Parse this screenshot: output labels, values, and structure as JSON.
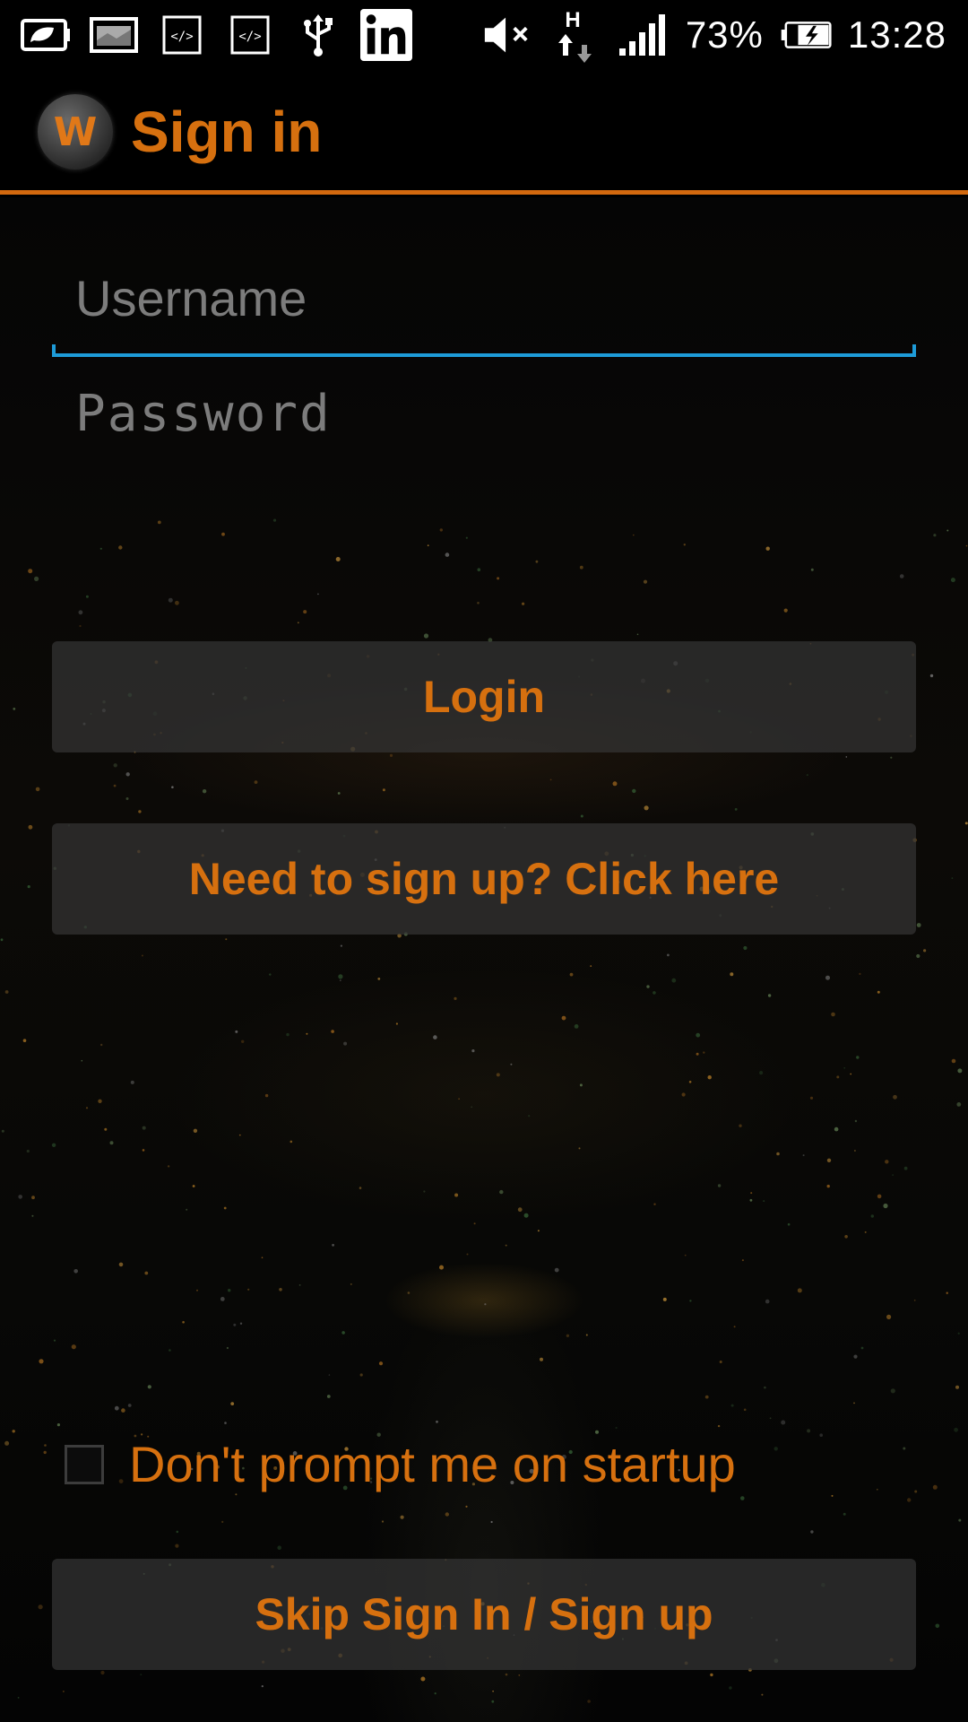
{
  "status_bar": {
    "battery_percent": "73%",
    "time": "13:28",
    "network_type": "H",
    "icons": [
      "battery-saver-icon",
      "image-icon",
      "code-icon",
      "code-icon",
      "usb-icon",
      "linkedin-icon",
      "mute-icon",
      "data-transfer-icon",
      "signal-icon",
      "battery-charging-icon"
    ]
  },
  "action_bar": {
    "logo_letter": "W",
    "title": "Sign in"
  },
  "form": {
    "username_placeholder": "Username",
    "password_placeholder": "Password",
    "login_label": "Login",
    "signup_label": "Need to sign up? Click here",
    "dont_prompt_label": "Don't prompt me on startup",
    "dont_prompt_checked": false,
    "skip_label": "Skip Sign In / Sign up"
  },
  "colors": {
    "accent": "#d6700f",
    "focus_underline": "#1e9bd8",
    "background": "#000000"
  }
}
